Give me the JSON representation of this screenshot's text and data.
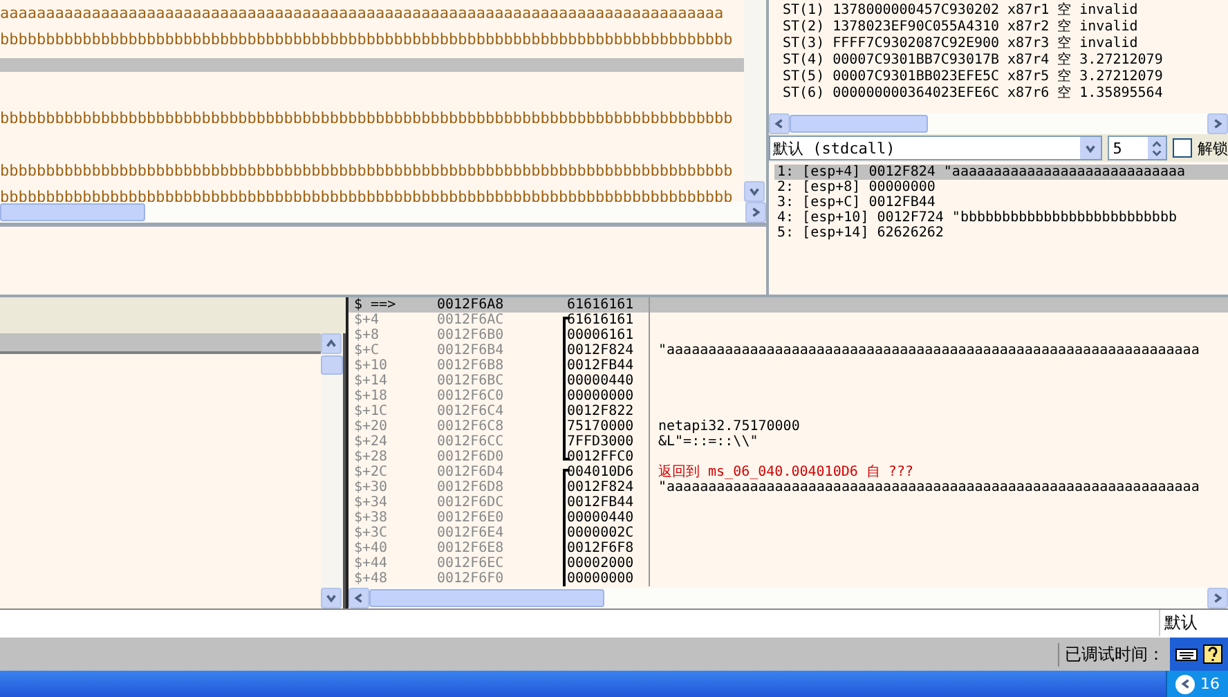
{
  "dump": {
    "rows": [
      {
        "text": "aaaaaaaaaaaaaaaaaaaaaaaaaaaaaaaaaaaaaaaaaaaaaaaaaaaaaaaaaaaaaaaaaaaaaaaaaaaaaaa",
        "selected": false
      },
      {
        "text": "bbbbbbbbbbbbbbbbbbbbbbbbbbbbbbbbbbbbbbbbbbbbbbbbbbbbbbbbbbbbbbbbbbbbbbbbbbbbbbbb",
        "selected": false
      },
      {
        "selected": true
      },
      {
        "selected": false
      },
      {
        "text": "bbbbbbbbbbbbbbbbbbbbbbbbbbbbbbbbbbbbbbbbbbbbbbbbbbbbbbbbbbbbbbbbbbbbbbbbbbbbbbbb",
        "selected": false
      },
      {
        "selected": false
      },
      {
        "text": "bbbbbbbbbbbbbbbbbbbbbbbbbbbbbbbbbbbbbbbbbbbbbbbbbbbbbbbbbbbbbbbbbbbbbbbbbbbbbbbb",
        "selected": false
      },
      {
        "text": "bbbbbbbbbbbbbbbbbbbbbbbbbbbbbbbbbbbbbbbbbbbbbbbbbbbbbbbbbbbbbbbbbbbbbbbbbbbbbbbb",
        "selected": false
      }
    ]
  },
  "fpu": {
    "rows": [
      {
        "reg": "ST(1)",
        "value": "1378000000457C930202",
        "tag": "x87r1",
        "state": "空",
        "number": "invalid"
      },
      {
        "reg": "ST(2)",
        "value": "1378023EF90C055A4310",
        "tag": "x87r2",
        "state": "空",
        "number": "invalid"
      },
      {
        "reg": "ST(3)",
        "value": "FFFF7C9302087C92E900",
        "tag": "x87r3",
        "state": "空",
        "number": "invalid"
      },
      {
        "reg": "ST(4)",
        "value": "00007C9301BB7C93017B",
        "tag": "x87r4",
        "state": "空",
        "number": "3.27212079"
      },
      {
        "reg": "ST(5)",
        "value": "00007C9301BB023EFE5C",
        "tag": "x87r5",
        "state": "空",
        "number": "3.27212079"
      },
      {
        "reg": "ST(6)",
        "value": "000000000364023EFE6C",
        "tag": "x87r6",
        "state": "空",
        "number": "1.35895564"
      }
    ]
  },
  "calling_convention": {
    "value": "默认 (stdcall)"
  },
  "arg_count": {
    "value": "5"
  },
  "unlock": {
    "label": "解锁",
    "checked": false
  },
  "call_args": [
    {
      "text": "1: [esp+4] 0012F824 \"aaaaaaaaaaaaaaaaaaaaaaaaaaaa",
      "selected": true
    },
    {
      "text": "2: [esp+8] 00000000",
      "selected": false
    },
    {
      "text": "3: [esp+C] 0012FB44",
      "selected": false
    },
    {
      "text": "4: [esp+10] 0012F724 \"bbbbbbbbbbbbbbbbbbbbbbbbbb",
      "selected": false
    },
    {
      "text": "5: [esp+14] 62626262",
      "selected": false
    }
  ],
  "stack": {
    "rows": [
      {
        "offset": "$ ==>",
        "address": "0012F6A8",
        "value": "61616161",
        "selected": true,
        "kind": "plain"
      },
      {
        "offset": "$+4",
        "address": "0012F6AC",
        "value": "61616161",
        "selected": false,
        "kind": "frame_start"
      },
      {
        "offset": "$+8",
        "address": "0012F6B0",
        "value": "00006161",
        "selected": false,
        "kind": "frame_mid"
      },
      {
        "offset": "$+C",
        "address": "0012F6B4",
        "value": "0012F824",
        "comment": "\"aaaaaaaaaaaaaaaaaaaaaaaaaaaaaaaaaaaaaaaaaaaaaaaaaaaaaaaaaaaaaaaa",
        "selected": false,
        "kind": "frame_mid"
      },
      {
        "offset": "$+10",
        "address": "0012F6B8",
        "value": "0012FB44",
        "selected": false,
        "kind": "frame_mid"
      },
      {
        "offset": "$+14",
        "address": "0012F6BC",
        "value": "00000440",
        "selected": false,
        "kind": "frame_mid"
      },
      {
        "offset": "$+18",
        "address": "0012F6C0",
        "value": "00000000",
        "selected": false,
        "kind": "frame_mid"
      },
      {
        "offset": "$+1C",
        "address": "0012F6C4",
        "value": "0012F822",
        "selected": false,
        "kind": "frame_mid"
      },
      {
        "offset": "$+20",
        "address": "0012F6C8",
        "value": "75170000",
        "comment": "netapi32.75170000",
        "selected": false,
        "kind": "frame_mid"
      },
      {
        "offset": "$+24",
        "address": "0012F6CC",
        "value": "7FFD3000",
        "comment": "&L\"=::=::\\\\\"",
        "selected": false,
        "kind": "frame_mid"
      },
      {
        "offset": "$+28",
        "address": "0012F6D0",
        "value": "0012FFC0",
        "selected": false,
        "kind": "frame_end"
      },
      {
        "offset": "$+2C",
        "address": "0012F6D4",
        "value": "004010D6",
        "comment": "返回到 ms_06_040.004010D6 自 ???",
        "color": "#d00000",
        "selected": false,
        "kind": "frame_start"
      },
      {
        "offset": "$+30",
        "address": "0012F6D8",
        "value": "0012F824",
        "comment": "\"aaaaaaaaaaaaaaaaaaaaaaaaaaaaaaaaaaaaaaaaaaaaaaaaaaaaaaaaaaaaaaaa",
        "selected": false,
        "kind": "frame_mid"
      },
      {
        "offset": "$+34",
        "address": "0012F6DC",
        "value": "0012FB44",
        "selected": false,
        "kind": "frame_mid"
      },
      {
        "offset": "$+38",
        "address": "0012F6E0",
        "value": "00000440",
        "selected": false,
        "kind": "frame_mid"
      },
      {
        "offset": "$+3C",
        "address": "0012F6E4",
        "value": "0000002C",
        "selected": false,
        "kind": "frame_mid"
      },
      {
        "offset": "$+40",
        "address": "0012F6E8",
        "value": "0012F6F8",
        "selected": false,
        "kind": "frame_mid"
      },
      {
        "offset": "$+44",
        "address": "0012F6EC",
        "value": "00002000",
        "selected": false,
        "kind": "frame_mid"
      },
      {
        "offset": "$+48",
        "address": "0012F6F0",
        "value": "00000000",
        "selected": false,
        "kind": "frame_mid"
      }
    ]
  },
  "command": {
    "mode": "默认"
  },
  "status_bar": {
    "label": "已调试时间："
  },
  "taskbar": {
    "clock": "16"
  }
}
